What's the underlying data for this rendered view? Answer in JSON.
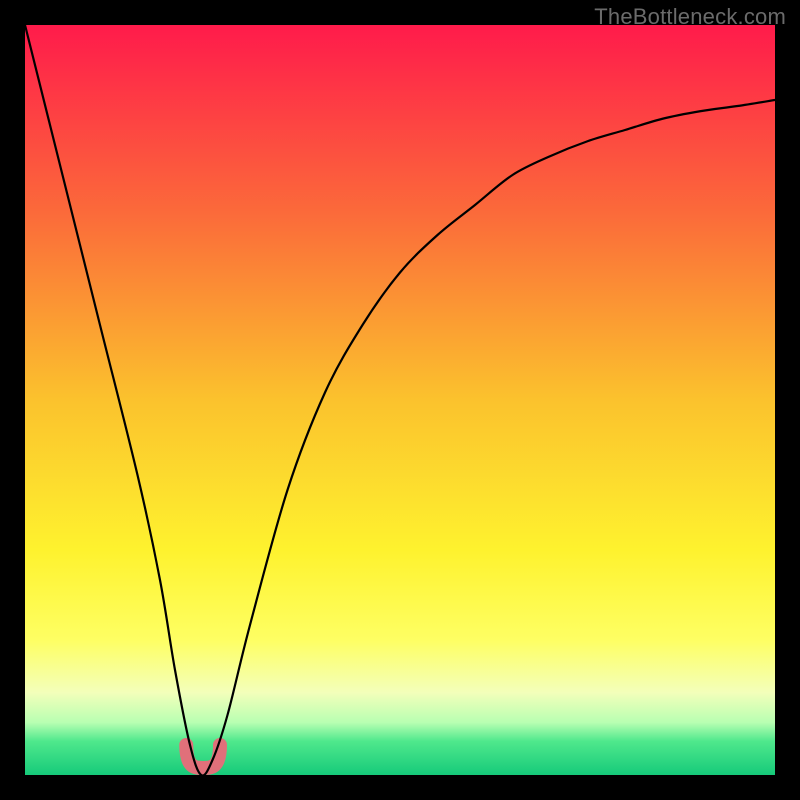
{
  "watermark": "TheBottleneck.com",
  "chart_data": {
    "type": "line",
    "title": "",
    "xlabel": "",
    "ylabel": "",
    "xlim": [
      0,
      100
    ],
    "ylim": [
      0,
      100
    ],
    "grid": false,
    "legend": false,
    "series": [
      {
        "name": "bottleneck-curve",
        "color": "#000000",
        "x": [
          0,
          5,
          10,
          15,
          18,
          20,
          22,
          23.5,
          25,
          27,
          30,
          35,
          40,
          45,
          50,
          55,
          60,
          65,
          70,
          75,
          80,
          85,
          90,
          95,
          100
        ],
        "y": [
          100,
          80,
          60,
          40,
          26,
          14,
          4,
          0,
          2,
          8,
          20,
          38,
          51,
          60,
          67,
          72,
          76,
          80,
          82.5,
          84.5,
          86,
          87.5,
          88.5,
          89.2,
          90
        ]
      }
    ],
    "highlight": {
      "name": "optimal-range",
      "color": "#e0707a",
      "x_range": [
        21.5,
        26
      ],
      "y_range": [
        0,
        4
      ]
    },
    "background_gradient": {
      "stops": [
        {
          "offset": 0.0,
          "color": "#ff1b4b"
        },
        {
          "offset": 0.25,
          "color": "#fb6a3a"
        },
        {
          "offset": 0.5,
          "color": "#fbc22d"
        },
        {
          "offset": 0.7,
          "color": "#fef22e"
        },
        {
          "offset": 0.82,
          "color": "#feff63"
        },
        {
          "offset": 0.89,
          "color": "#f3ffba"
        },
        {
          "offset": 0.93,
          "color": "#b8ffb2"
        },
        {
          "offset": 0.955,
          "color": "#4fe88c"
        },
        {
          "offset": 1.0,
          "color": "#16ca7a"
        }
      ]
    }
  }
}
